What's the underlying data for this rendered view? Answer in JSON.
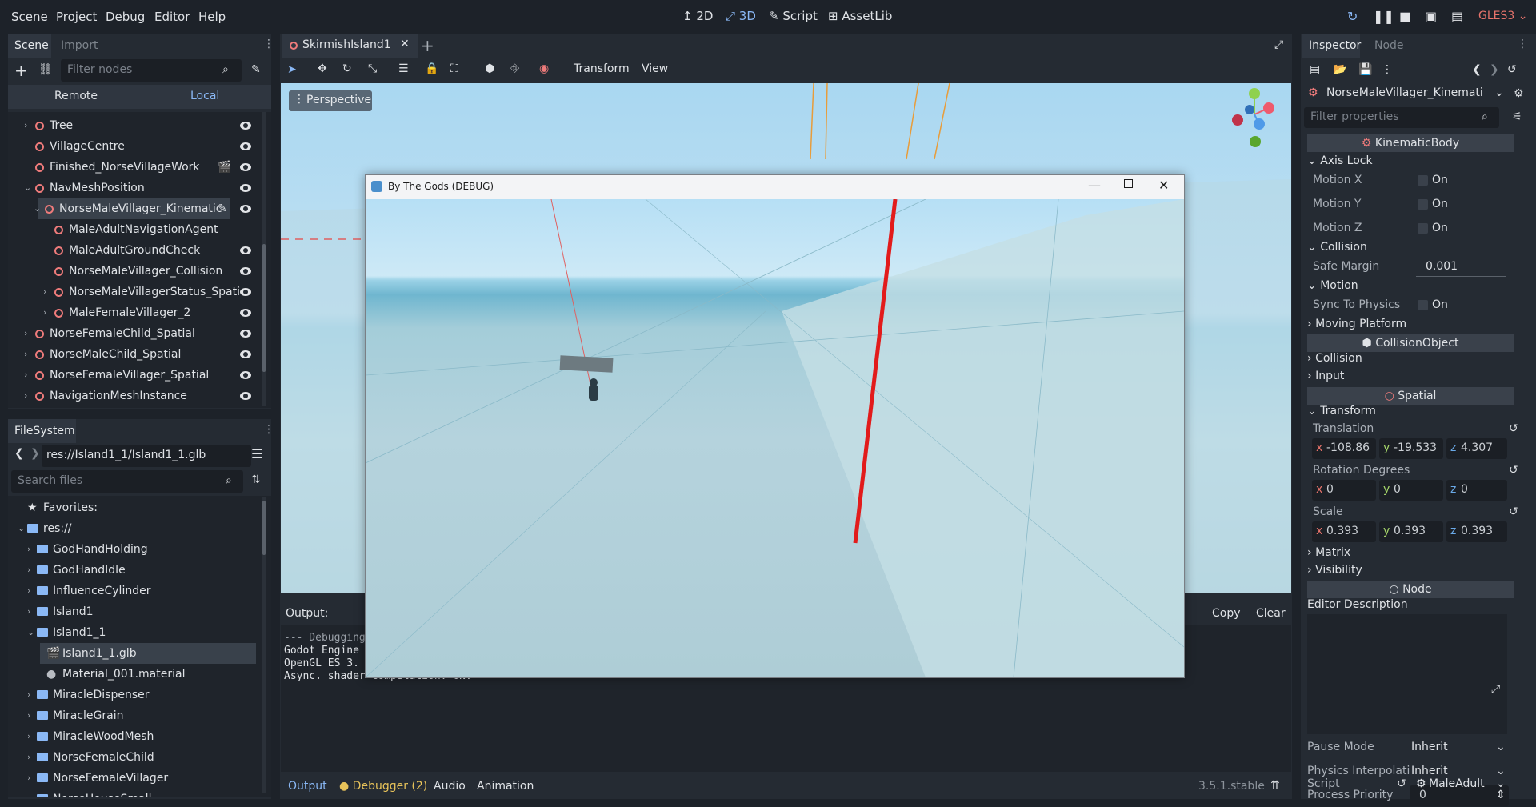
{
  "menubar": {
    "menus": [
      "Scene",
      "Project",
      "Debug",
      "Editor",
      "Help"
    ],
    "modes": {
      "m2d": "2D",
      "m3d": "3D",
      "script": "Script",
      "assetlib": "AssetLib"
    },
    "renderer": "GLES3"
  },
  "scene_panel": {
    "tabs": {
      "scene": "Scene",
      "import": "Import"
    },
    "filter_placeholder": "Filter nodes",
    "remote": "Remote",
    "local": "Local",
    "nodes": [
      {
        "label": "Tree",
        "depth": 0,
        "arrow": ">"
      },
      {
        "label": "VillageCentre",
        "depth": 0,
        "arrow": ""
      },
      {
        "label": "Finished_NorseVillageWork",
        "depth": 0,
        "arrow": ""
      },
      {
        "label": "NavMeshPosition",
        "depth": 0,
        "arrow": "v"
      },
      {
        "label": "NorseMaleVillager_Kinematic",
        "depth": 1,
        "arrow": "v"
      },
      {
        "label": "MaleAdultNavigationAgent",
        "depth": 2,
        "arrow": ""
      },
      {
        "label": "MaleAdultGroundCheck",
        "depth": 2,
        "arrow": ""
      },
      {
        "label": "NorseMaleVillager_Collision",
        "depth": 2,
        "arrow": ""
      },
      {
        "label": "NorseMaleVillagerStatus_Spati",
        "depth": 2,
        "arrow": ">"
      },
      {
        "label": "MaleFemaleVillager_2",
        "depth": 2,
        "arrow": ">"
      },
      {
        "label": "NorseFemaleChild_Spatial",
        "depth": 0,
        "arrow": ">"
      },
      {
        "label": "NorseMaleChild_Spatial",
        "depth": 0,
        "arrow": ">"
      },
      {
        "label": "NorseFemaleVillager_Spatial",
        "depth": 0,
        "arrow": ">"
      },
      {
        "label": "NavigationMeshInstance",
        "depth": 0,
        "arrow": ">"
      }
    ]
  },
  "filesystem": {
    "tab": "FileSystem",
    "path": "res://Island1_1/Island1_1.glb",
    "search_placeholder": "Search files",
    "items": [
      {
        "label": "Favorites:",
        "depth": 0,
        "kind": "star"
      },
      {
        "label": "res://",
        "depth": 0,
        "kind": "folder-open"
      },
      {
        "label": "GodHandHolding",
        "depth": 1,
        "kind": "folder"
      },
      {
        "label": "GodHandIdle",
        "depth": 1,
        "kind": "folder"
      },
      {
        "label": "InfluenceCylinder",
        "depth": 1,
        "kind": "folder"
      },
      {
        "label": "Island1",
        "depth": 1,
        "kind": "folder"
      },
      {
        "label": "Island1_1",
        "depth": 1,
        "kind": "folder-open"
      },
      {
        "label": "Island1_1.glb",
        "depth": 2,
        "kind": "scene"
      },
      {
        "label": "Material_001.material",
        "depth": 2,
        "kind": "material"
      },
      {
        "label": "MiracleDispenser",
        "depth": 1,
        "kind": "folder"
      },
      {
        "label": "MiracleGrain",
        "depth": 1,
        "kind": "folder"
      },
      {
        "label": "MiracleWoodMesh",
        "depth": 1,
        "kind": "folder"
      },
      {
        "label": "NorseFemaleChild",
        "depth": 1,
        "kind": "folder"
      },
      {
        "label": "NorseFemaleVillager",
        "depth": 1,
        "kind": "folder"
      },
      {
        "label": "NorseHouseSmall",
        "depth": 1,
        "kind": "folder"
      }
    ]
  },
  "editor": {
    "scene_tab": "SkirmishIsland1",
    "toolbar": {
      "transform": "Transform",
      "view": "View"
    },
    "perspective": "Perspective"
  },
  "game_window": {
    "title": "By The Gods (DEBUG)"
  },
  "output": {
    "label": "Output:",
    "copy": "Copy",
    "clear": "Clear",
    "lines": [
      "--- Debugging",
      "Godot Engine",
      "OpenGL ES 3.",
      "Async. shader compilation: ON."
    ]
  },
  "bottombar": {
    "tabs": [
      "Output",
      "Debugger (2)",
      "Audio",
      "Animation"
    ],
    "version": "3.5.1.stable"
  },
  "inspector": {
    "tabs": {
      "inspector": "Inspector",
      "node": "Node"
    },
    "node_name": "NorseMaleVillager_Kinemati",
    "filter_placeholder": "Filter properties",
    "sections": {
      "kinematic": "KinematicBody",
      "collision_object": "CollisionObject",
      "spatial": "Spatial",
      "node": "Node"
    },
    "axis_lock": "Axis Lock",
    "motion_x": "Motion X",
    "motion_y": "Motion Y",
    "motion_z": "Motion Z",
    "on": "On",
    "collision": "Collision",
    "safe_margin": "Safe Margin",
    "safe_margin_value": "0.001",
    "motion": "Motion",
    "sync_to_physics": "Sync To Physics",
    "moving_platform": "Moving Platform",
    "collision2": "Collision",
    "input": "Input",
    "transform": "Transform",
    "translation": "Translation",
    "translation_values": {
      "x": "-108.86",
      "y": "-19.533",
      "z": "4.307"
    },
    "rotation": "Rotation Degrees",
    "rotation_values": {
      "x": "0",
      "y": "0",
      "z": "0"
    },
    "scale": "Scale",
    "scale_values": {
      "x": "0.393",
      "y": "0.393",
      "z": "0.393"
    },
    "matrix": "Matrix",
    "visibility": "Visibility",
    "editor_description": "Editor Description",
    "pause_mode": "Pause Mode",
    "pause_mode_value": "Inherit",
    "physics_interp": "Physics Interpolati",
    "physics_interp_value": "Inherit",
    "process_priority": "Process Priority",
    "process_priority_value": "0",
    "script": "Script",
    "script_value": "MaleAdult"
  },
  "colors": {
    "accent": "#8ab8f5",
    "node_red": "#ee7b7b",
    "panel": "#252b33",
    "background": "#1d2229"
  }
}
